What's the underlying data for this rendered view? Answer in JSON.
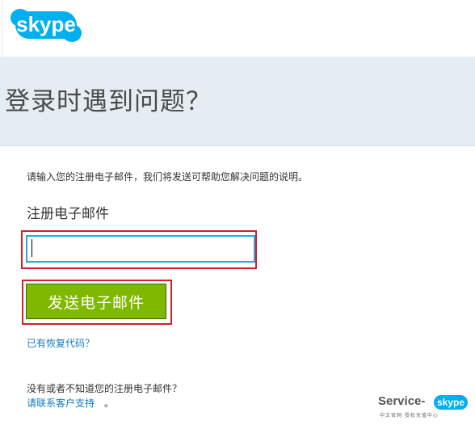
{
  "header": {
    "logo_text": "skype",
    "brand_color": "#00aff0"
  },
  "banner": {
    "title": "登录时遇到问题？",
    "background": "#e5edf2"
  },
  "form": {
    "instructions": "请输入您的注册电子邮件，我们将发送可帮助您解决问题的说明。",
    "email_label": "注册电子邮件",
    "email_value": "",
    "send_label": "发送电子邮件",
    "button_color": "#7fb800"
  },
  "links": {
    "recovery_code": "已有恢复代码？",
    "footer_question": "没有或者不知道您的注册电子邮件？",
    "support": "请联系客户支持",
    "support_suffix": "。"
  },
  "watermark": {
    "service": "Service-",
    "badge": "skype",
    "sub": "中文官网 授权充值中心"
  },
  "colors": {
    "link": "#0f7bc0",
    "highlight_border": "#d0212a",
    "input_border": "#2aa7df"
  }
}
